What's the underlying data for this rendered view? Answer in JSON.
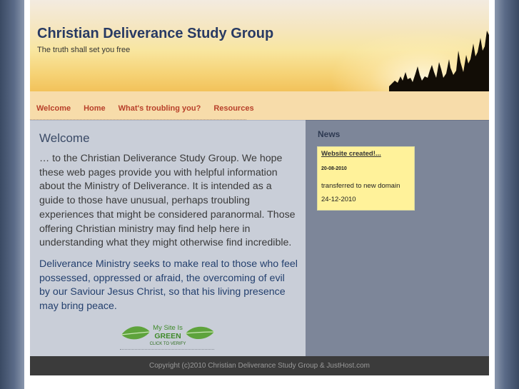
{
  "header": {
    "title": "Christian Deliverance Study Group",
    "tagline": "The truth shall set you free"
  },
  "nav": {
    "items": [
      {
        "label": "Welcome"
      },
      {
        "label": "Home"
      },
      {
        "label": "What's troubling you?"
      },
      {
        "label": "Resources"
      }
    ]
  },
  "main": {
    "heading": "Welcome",
    "intro": "… to the Christian Deliverance Study Group.  We hope these web pages provide you with helpful information about the Ministry of Deliverance.  It is intended as a guide to those have unusual, perhaps troubling experiences that might be considered paranormal.  Those offering Christian ministry may find help here in understanding what they might otherwise find incredible.",
    "mission": "Deliverance Ministry seeks to make real to those who feel possessed, oppressed or afraid, the overcoming of evil by our Saviour Jesus Christ, so that his living presence may bring peace.",
    "badge": {
      "line1": "My Site Is",
      "line2": "GREEN",
      "line3": "CLICK TO VERIFY"
    }
  },
  "sidebar": {
    "heading": "News",
    "news": {
      "link": "Website created!...",
      "date": "20-08-2010",
      "body": "transferred to new domain 24-12-2010"
    }
  },
  "footer": {
    "copyright": "Copyright (c)2010 Christian Deliverance Study Group & JustHost.com"
  },
  "colors": {
    "title": "#283a63",
    "nav_link": "#b8402a",
    "main_bg": "#c9ced8",
    "sidebar_bg": "#7d8699",
    "news_bg": "#fff29a",
    "footer_bg": "#3b3b3b"
  }
}
